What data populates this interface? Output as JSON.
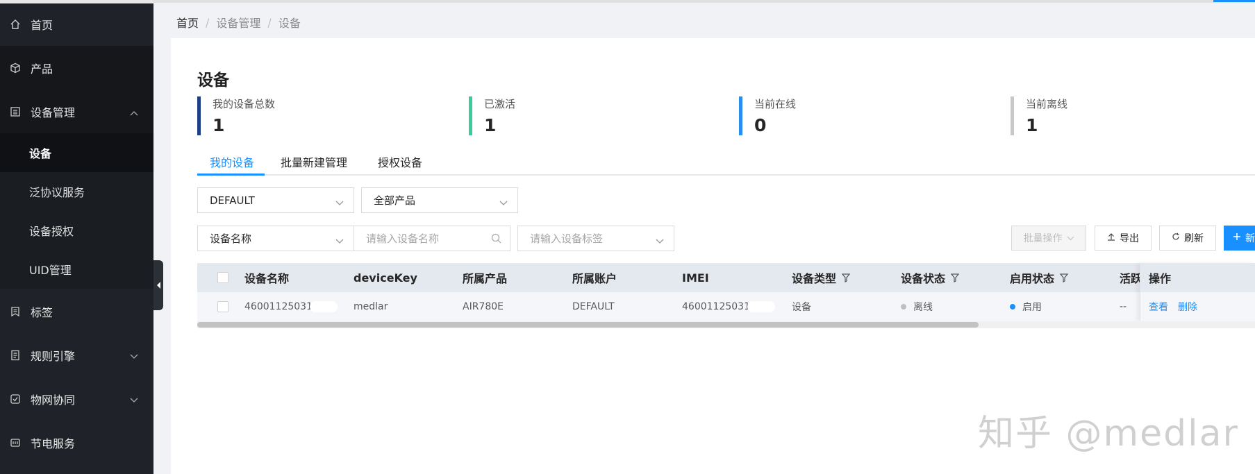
{
  "sidebar": {
    "home": "首页",
    "product": "产品",
    "device_mgmt": "设备管理",
    "sub": [
      "设备",
      "泛协议服务",
      "设备授权",
      "UID管理"
    ],
    "tag": "标签",
    "rule_engine": "规则引擎",
    "iot_collab": "物网协同",
    "power_service": "节电服务"
  },
  "breadcrumb": [
    "首页",
    "设备管理",
    "设备"
  ],
  "breadcrumb_sep": "/",
  "page_title": "设备",
  "stats": [
    {
      "label": "我的设备总数",
      "value": "1",
      "color": "#1d3f87"
    },
    {
      "label": "已激活",
      "value": "1",
      "color": "#3ccb9c"
    },
    {
      "label": "当前在线",
      "value": "0",
      "color": "#2d8cf0"
    },
    {
      "label": "当前离线",
      "value": "1",
      "color": "#c8c8c8"
    }
  ],
  "tabs": [
    "我的设备",
    "批量新建管理",
    "授权设备"
  ],
  "filters": {
    "account": "DEFAULT",
    "product": "全部产品",
    "field": "设备名称",
    "name_placeholder": "请输入设备名称",
    "tag_placeholder": "请输入设备标签"
  },
  "buttons": {
    "batch": "批量操作",
    "export": "导出",
    "refresh": "刷新",
    "new": "新"
  },
  "table": {
    "headers": [
      "设备名称",
      "deviceKey",
      "所属产品",
      "所属账户",
      "IMEI",
      "设备类型",
      "设备状态",
      "启用状态",
      "活跃",
      "操作"
    ],
    "row": {
      "name": "46001125031",
      "device_key": "medlar",
      "product": "AIR780E",
      "account": "DEFAULT",
      "imei": "46001125031",
      "type": "设备",
      "status": "离线",
      "enabled": "启用",
      "active": "--",
      "view": "查看",
      "delete": "删除"
    }
  },
  "watermark": "知乎 @medlar"
}
